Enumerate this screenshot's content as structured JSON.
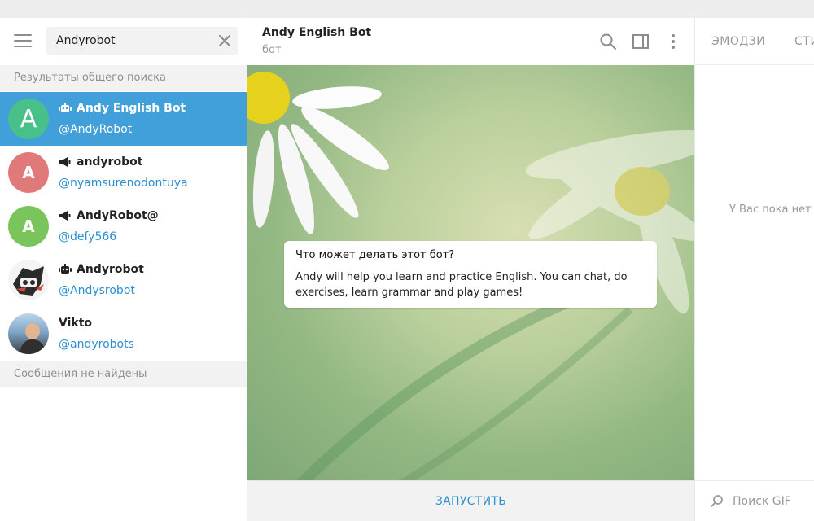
{
  "search": {
    "value": "Andyrobot"
  },
  "sections": {
    "global_results": "Результаты общего поиска",
    "no_messages": "Сообщения не найдены"
  },
  "results": [
    {
      "title": "Andy English Bot",
      "subtitle": "@AndyRobot",
      "avatar_letter": "A",
      "avatar_color": "#47c08a",
      "kind": "bot-icon",
      "active": true
    },
    {
      "title": "andyrobot",
      "subtitle": "@nyamsurenodontuya",
      "avatar_letter": "A",
      "avatar_color": "#e07a7a",
      "kind": "channel-icon",
      "active": false
    },
    {
      "title": "AndyRobot@",
      "subtitle": "@defy566",
      "avatar_letter": "A",
      "avatar_color": "#79c55c",
      "kind": "channel-icon",
      "active": false
    },
    {
      "title": "Andyrobot",
      "subtitle": "@Andysrobot",
      "avatar_letter": "",
      "avatar_color": "#3a3a3a",
      "kind": "bot-icon",
      "active": false
    },
    {
      "title": "Vikto",
      "subtitle": "@andyrobots",
      "avatar_letter": "",
      "avatar_color": "#7fa7c9",
      "kind": "none",
      "active": false
    }
  ],
  "chat": {
    "title": "Andy English Bot",
    "status": "бот",
    "card_title": "Что может делать этот бот?",
    "card_text": "Andy will help you learn and practice English. You can chat, do exercises, learn grammar and play games!",
    "start_label": "ЗАПУСТИТЬ"
  },
  "panel": {
    "tab_emoji": "ЭМОДЗИ",
    "tab_stickers": "СТИ",
    "empty_text": "У Вас пока нет с",
    "gif_placeholder": "Поиск GIF"
  },
  "colors": {
    "accent": "#419fd9",
    "link": "#2a8fd1"
  }
}
